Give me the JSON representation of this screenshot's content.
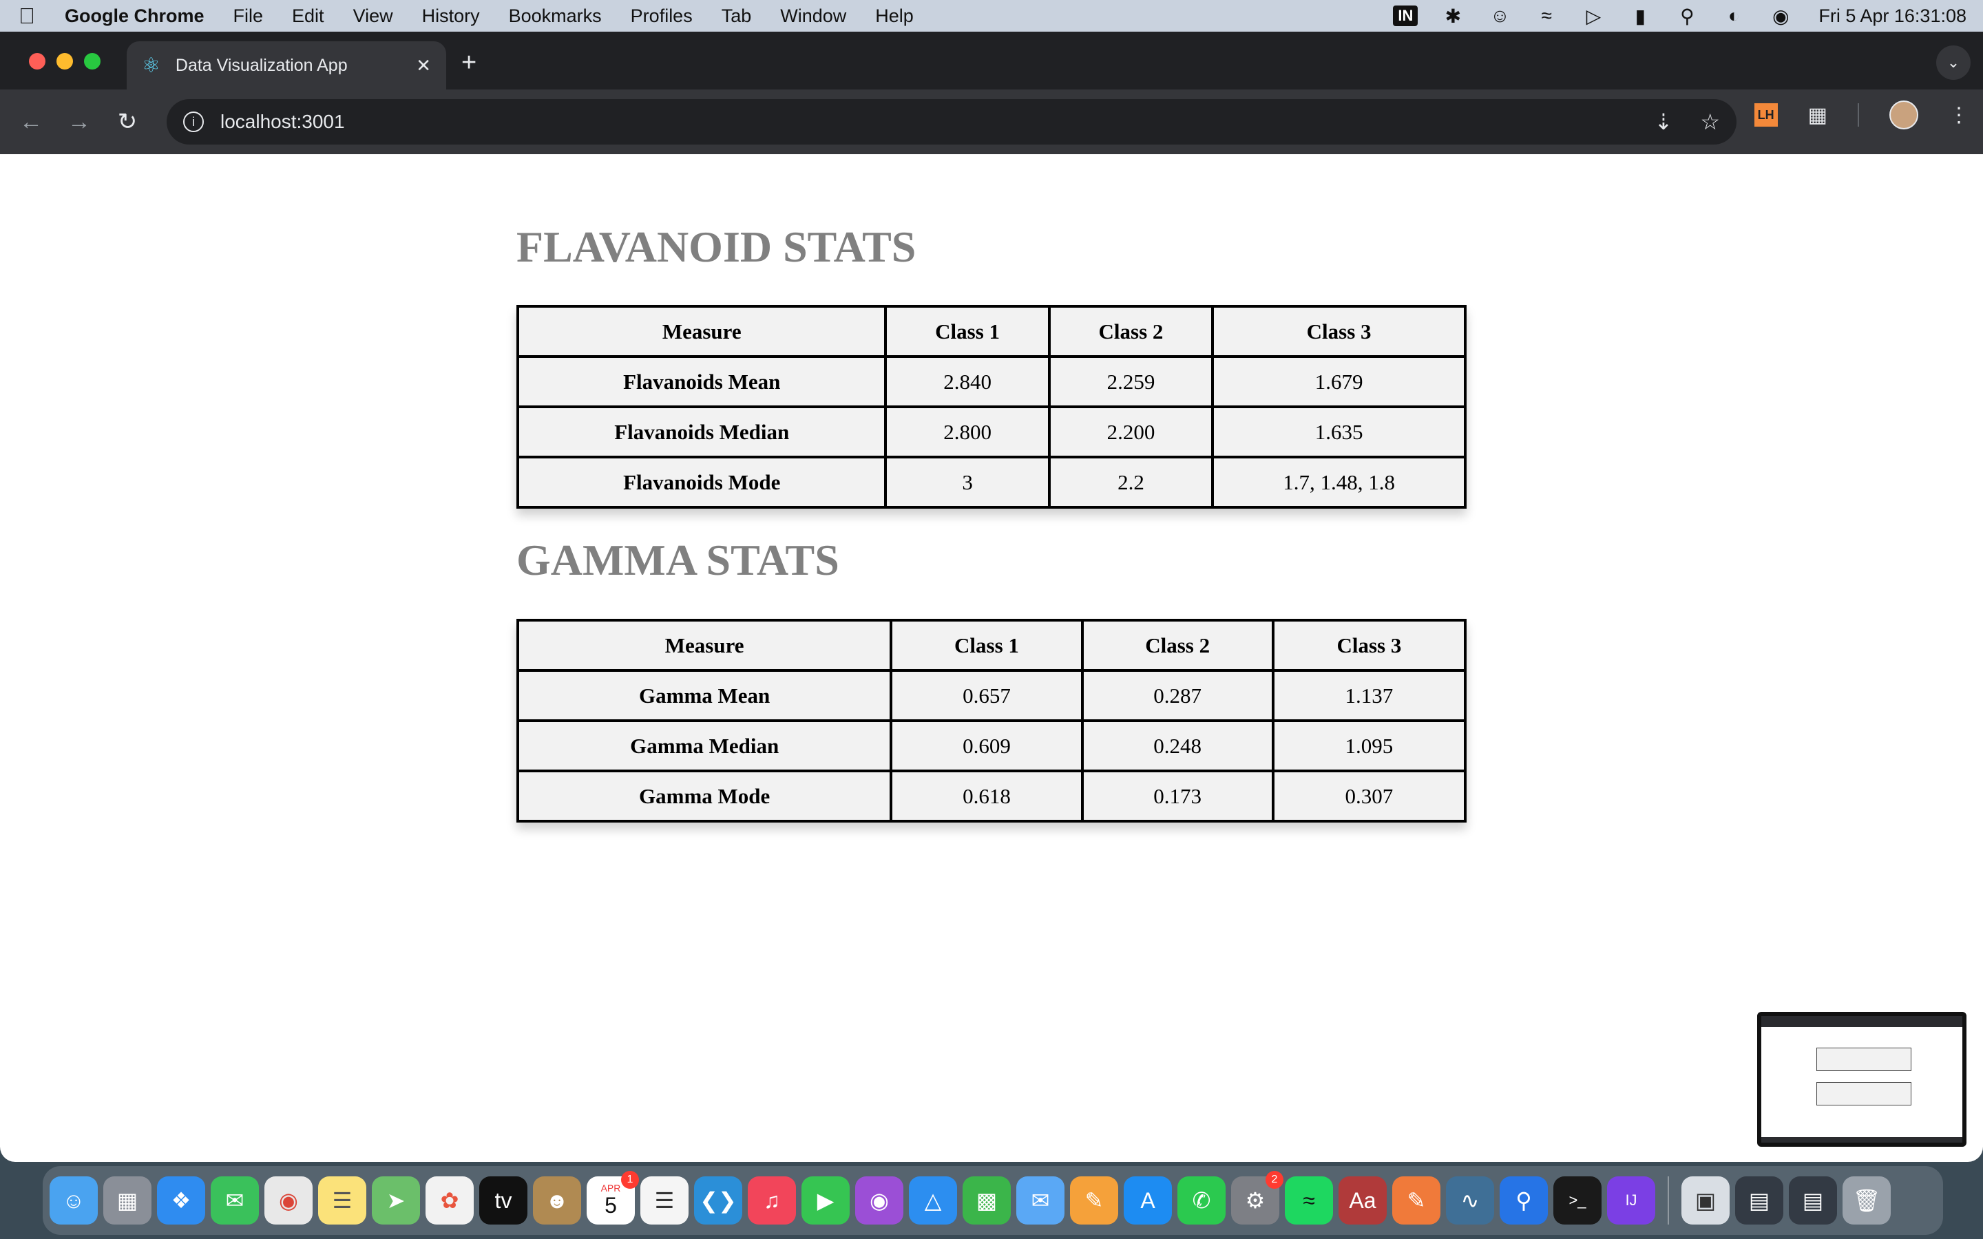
{
  "menubar": {
    "apple_icon": "apple-logo",
    "app_name": "Google Chrome",
    "menus": [
      "File",
      "Edit",
      "View",
      "History",
      "Bookmarks",
      "Profiles",
      "Tab",
      "Window",
      "Help"
    ],
    "input_source": "IN",
    "datetime": "Fri 5 Apr  16:31:08"
  },
  "browser": {
    "tab_title": "Data Visualization App",
    "url": "localhost:3001"
  },
  "flavanoid": {
    "title": "FLAVANOID STATS",
    "headers": [
      "Measure",
      "Class 1",
      "Class 2",
      "Class 3"
    ],
    "rows": [
      [
        "Flavanoids Mean",
        "2.840",
        "2.259",
        "1.679"
      ],
      [
        "Flavanoids Median",
        "2.800",
        "2.200",
        "1.635"
      ],
      [
        "Flavanoids Mode",
        "3",
        "2.2",
        "1.7, 1.48, 1.8"
      ]
    ]
  },
  "gamma": {
    "title": "GAMMA STATS",
    "headers": [
      "Measure",
      "Class 1",
      "Class 2",
      "Class 3"
    ],
    "rows": [
      [
        "Gamma Mean",
        "0.657",
        "0.287",
        "1.137"
      ],
      [
        "Gamma Median",
        "0.609",
        "0.248",
        "1.095"
      ],
      [
        "Gamma Mode",
        "0.618",
        "0.173",
        "0.307"
      ]
    ]
  },
  "dock": {
    "calendar_month": "APR",
    "calendar_day": "5",
    "calendar_badge": "1",
    "settings_badge": "2"
  },
  "colors": {
    "title_gray": "#808080",
    "table_bg": "#f2f2f2",
    "chrome_dark": "#202124",
    "chrome_toolbar": "#35363a"
  }
}
